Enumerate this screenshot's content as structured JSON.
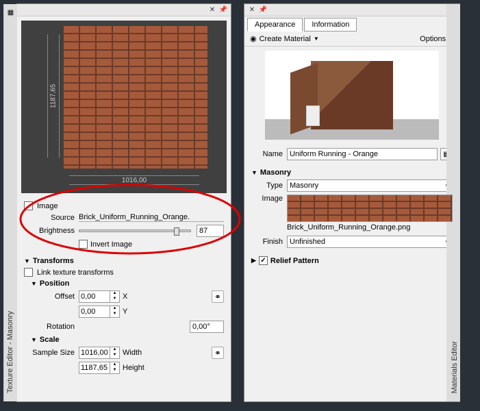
{
  "left_panel": {
    "title": "Texture Editor - Masonry",
    "preview": {
      "dim_v": "1187,65",
      "dim_h": "1016,00"
    },
    "image": {
      "header": "Image",
      "source_label": "Source",
      "source_value": "Brick_Uniform_Running_Orange.",
      "brightness_label": "Brightness",
      "brightness_value": "87",
      "invert_label": "Invert Image"
    },
    "transforms": {
      "header": "Transforms",
      "link_label": "Link texture transforms",
      "position": {
        "header": "Position",
        "offset_label": "Offset",
        "offset_x": "0,00",
        "offset_y": "0,00",
        "x_label": "X",
        "y_label": "Y",
        "rotation_label": "Rotation",
        "rotation_value": "0,00°"
      },
      "scale": {
        "header": "Scale",
        "sample_label": "Sample Size",
        "width": "1016,00",
        "height": "1187,65",
        "width_label": "Width",
        "height_label": "Height"
      }
    }
  },
  "right_panel": {
    "title": "Materials Editor",
    "tabs": {
      "appearance": "Appearance",
      "information": "Information"
    },
    "create_label": "Create Material",
    "options_label": "Options",
    "name_label": "Name",
    "name_value": "Uniform Running - Orange",
    "masonry": {
      "header": "Masonry",
      "type_label": "Type",
      "type_value": "Masonry",
      "image_label": "Image",
      "image_file": "Brick_Uniform_Running_Orange.png",
      "finish_label": "Finish",
      "finish_value": "Unfinished"
    },
    "relief_header": "Relief Pattern"
  }
}
